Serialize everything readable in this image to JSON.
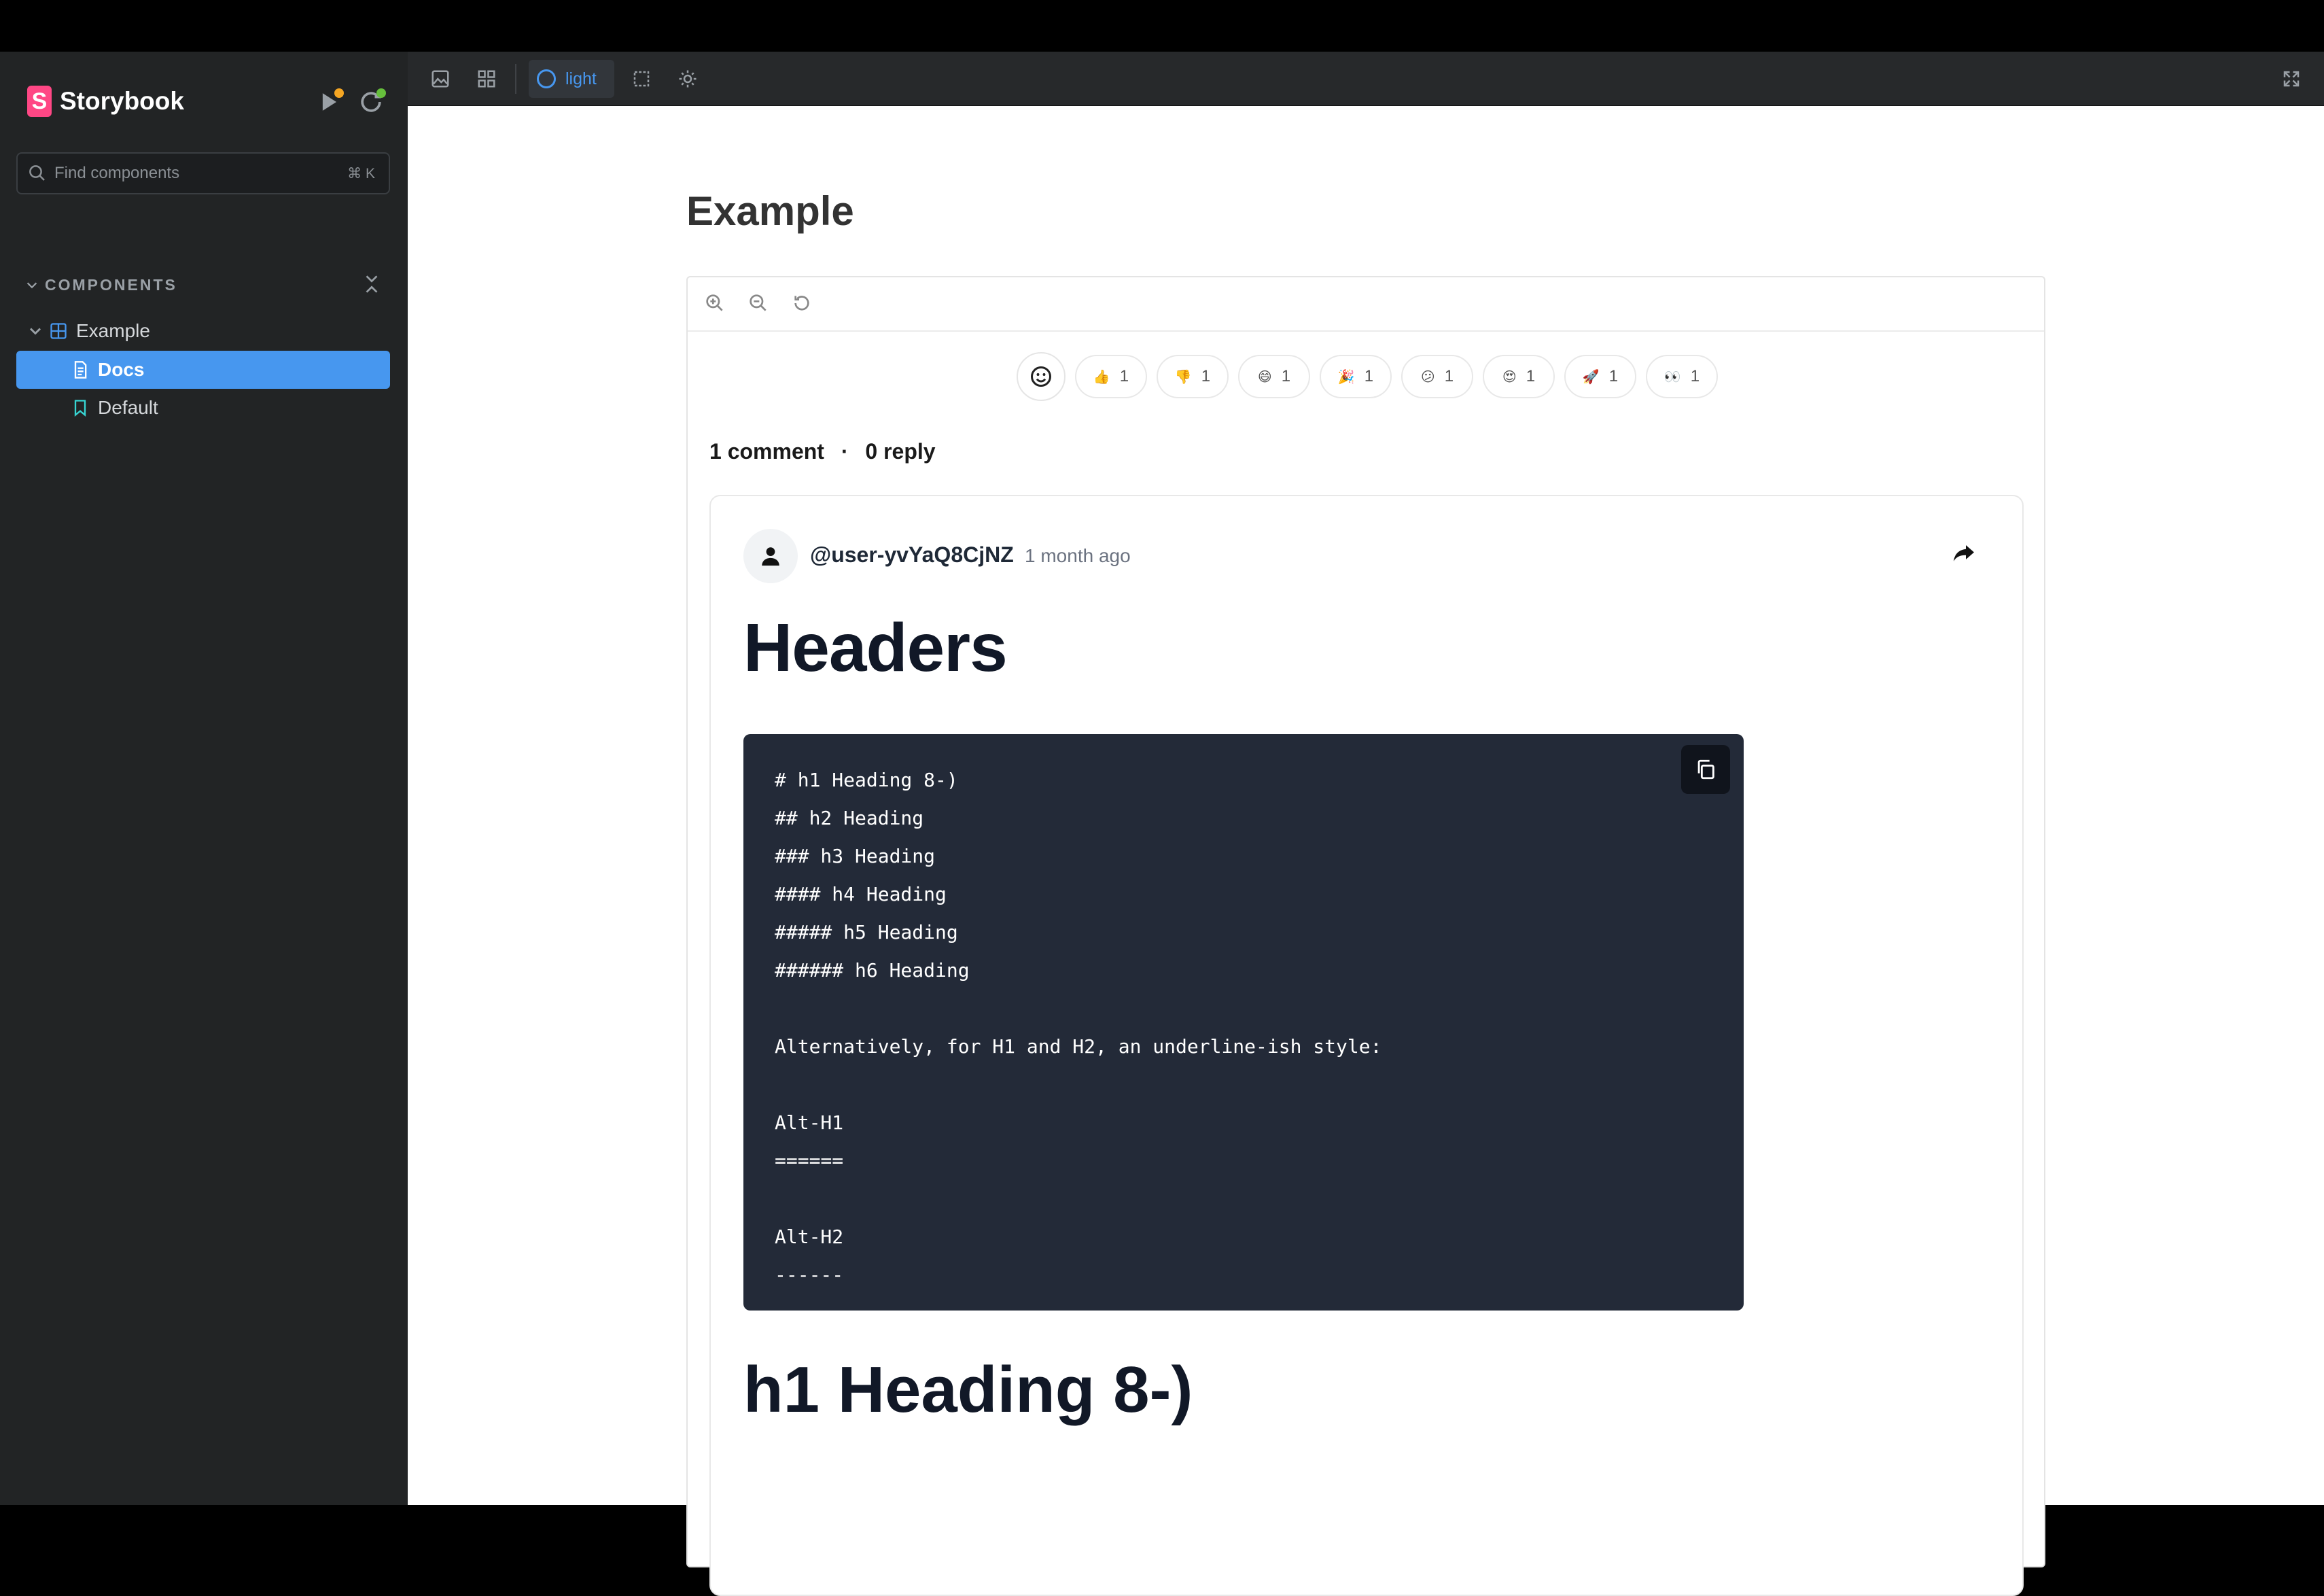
{
  "app": {
    "name": "Storybook"
  },
  "sidebar": {
    "search_placeholder": "Find components",
    "search_shortcut": "⌘ K",
    "section": "COMPONENTS",
    "tree": [
      {
        "label": "Example",
        "type": "component"
      },
      {
        "label": "Docs",
        "type": "docs",
        "selected": true
      },
      {
        "label": "Default",
        "type": "story"
      }
    ]
  },
  "toolbar": {
    "theme_label": "light"
  },
  "docs": {
    "title": "Example"
  },
  "reactions": [
    {
      "emoji": "👍",
      "count": "1"
    },
    {
      "emoji": "👎",
      "count": "1"
    },
    {
      "emoji": "😄",
      "count": "1"
    },
    {
      "emoji": "🎉",
      "count": "1"
    },
    {
      "emoji": "😕",
      "count": "1"
    },
    {
      "emoji": "😍",
      "count": "1"
    },
    {
      "emoji": "🚀",
      "count": "1"
    },
    {
      "emoji": "👀",
      "count": "1"
    }
  ],
  "comments": {
    "count_label": "1 comment",
    "separator": "·",
    "reply_label": "0 reply"
  },
  "comment": {
    "user": "@user-yvYaQ8CjNZ",
    "time": "1 month ago",
    "heading": "Headers",
    "code_lines": [
      "# h1 Heading 8-)",
      "## h2 Heading",
      "### h3 Heading",
      "#### h4 Heading",
      "##### h5 Heading",
      "###### h6 Heading",
      "",
      "Alternatively, for H1 and H2, an underline-ish style:",
      "",
      "Alt-H1",
      "======",
      "",
      "Alt-H2",
      "------"
    ],
    "rendered_h1": "h1 Heading 8-)"
  },
  "colors": {
    "accent": "#4797ef",
    "brand": "#ff4785",
    "sidebar_bg": "#222425",
    "code_bg": "#232a38"
  }
}
